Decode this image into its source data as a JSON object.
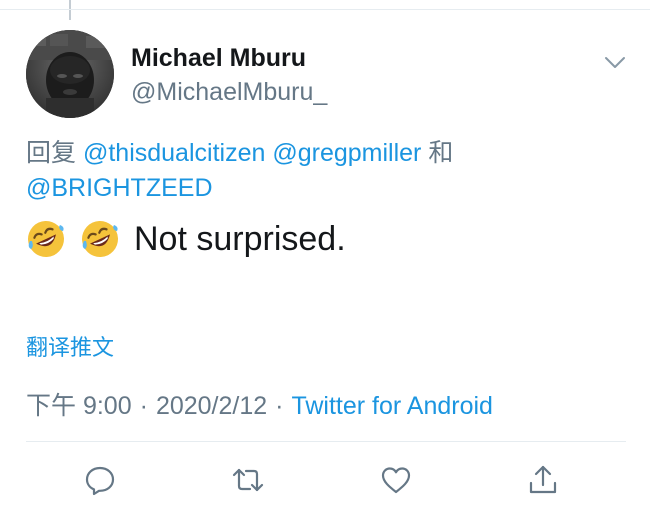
{
  "tweet": {
    "author": {
      "display_name": "Michael Mburu",
      "handle": "@MichaelMburu_",
      "avatar_icon": "profile-photo"
    },
    "reply_context": {
      "prefix": "回复",
      "mentions": [
        "@thisdualcitizen",
        "@gregpmiller"
      ],
      "conjunction": "和",
      "last_mention": "@BRIGHTZEED"
    },
    "text": {
      "emojis": [
        "rolling-on-the-floor-laughing-emoji",
        "rolling-on-the-floor-laughing-emoji"
      ],
      "body": "Not surprised."
    },
    "translate_label": "翻译推文",
    "meta": {
      "time": "下午 9:00",
      "separator": "·",
      "date": "2020/2/12",
      "source": "Twitter for Android"
    }
  },
  "actions": {
    "reply_icon": "reply-icon",
    "retweet_icon": "retweet-icon",
    "like_icon": "like-icon",
    "share_icon": "share-icon"
  },
  "colors": {
    "link": "#1b95e0",
    "secondary_text": "#657786",
    "primary_text": "#14171a",
    "divider": "#e6ecf0"
  }
}
